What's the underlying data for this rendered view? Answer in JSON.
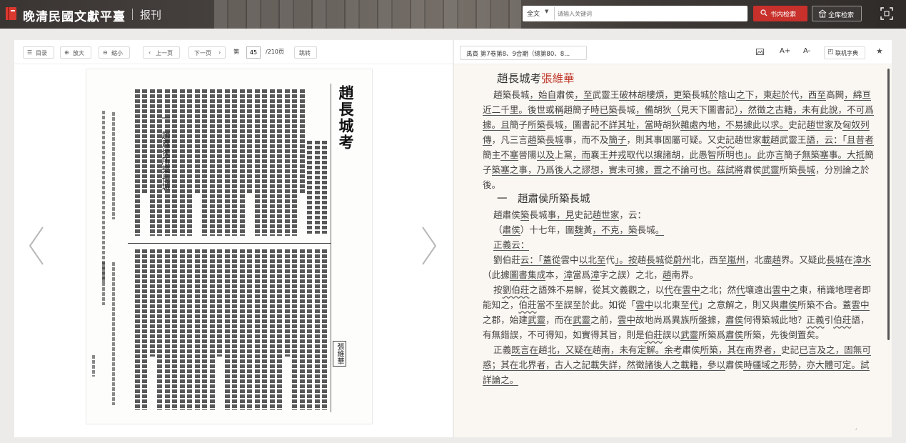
{
  "header": {
    "app_title": "晚清民國文獻平臺",
    "section": "报刊",
    "search": {
      "scope": "全文",
      "placeholder": "请输入关键词"
    },
    "search_in_book": "书内检索",
    "search_all": "全库检索"
  },
  "reader_toolbar": {
    "toc": "目录",
    "zoom_in": "放大",
    "zoom_out": "缩小",
    "prev": "上一页",
    "next": "下一页",
    "page_prefix": "第",
    "page_value": "45",
    "page_total": "/210页",
    "jump": "跳转"
  },
  "scan": {
    "title": "趙長城考",
    "section": "一　趙肅侯所築長城",
    "author": "張維華"
  },
  "text_toolbar": {
    "issue": "禹貢 第7卷第8、9合期（總第80、8...",
    "font_up": "A+",
    "font_down": "A-",
    "dictionary": "联机字典"
  },
  "article": {
    "title": "趙長城考",
    "author": "張維華",
    "p1": [
      "趙築長城",
      "，始自",
      "肅侯",
      "，至",
      "武靈王",
      "破林胡樓煩，更築",
      "長城",
      "於",
      "陰山",
      "之下，東起於",
      "代",
      "，西至",
      "高闕",
      "，綿亘近二千里。後世或稱",
      "趙簡子",
      "時已築",
      "長城",
      "，備",
      "胡狄",
      "（",
      "見天下圖書記",
      "），然徵之古籍，未有此說，不可爲據。且",
      "簡子",
      "所築",
      "長城",
      "，",
      "圖書記",
      "不詳其址，當時",
      "胡狄",
      "雜處內地，不易據此以求。",
      "史記",
      "趙世家",
      "及",
      "匈奴列傳",
      "，凡三言",
      "趙",
      "築",
      "長城",
      "事，而不及",
      "簡子",
      "，則其事固屬可疑。又",
      "史記",
      "趙世家",
      "載",
      "趙武靈王",
      "語，云：「且昔者",
      "簡主",
      "不塞",
      "晉陽",
      "以及",
      "上黨",
      "，而",
      "襄王",
      "并戎取代以攘諸胡，此愚智所明也」。此亦言",
      "簡子",
      "無築塞事。大抵",
      "簡子",
      "築塞之事，乃爲後人之謬想，實未可據，置之不論可也。茲試將",
      "肅侯",
      "武靈",
      "所築",
      "長城",
      "，分別論之於後。"
    ],
    "section1": "一　趙肅侯所築長城",
    "l1": [
      "趙肅侯",
      "築",
      "長城",
      "事，見",
      "史記",
      "趙世家",
      "，云："
    ],
    "l2": [
      "（",
      "肅侯",
      "）十七年，圍",
      "魏",
      "黃",
      "，不克，築",
      "長城",
      "。"
    ],
    "l3": "正義云：",
    "p2": [
      "劉伯莊",
      "云：「蓋從",
      "雲中",
      "以北至",
      "代",
      "」。按",
      "趙",
      "長城",
      "從",
      "蔚州",
      "北，西至",
      "嵐州",
      "，北盡",
      "趙",
      "界。又疑此",
      "長城",
      "在",
      "漳水",
      "（此據",
      "圖書集成",
      "本，",
      "漳",
      "當爲",
      "漳",
      "字之誤）之北，",
      "趙",
      "南界。"
    ],
    "p3": [
      "按",
      "劉伯莊",
      "之語殊不易解，從其文義觀之，以",
      "代",
      "在",
      "雲中",
      "之北；然",
      "代",
      "壤遠出",
      "雲中",
      "之東，稍識地理者即能知之，",
      "伯莊",
      "當不至誤至於此。如從「",
      "雲中",
      "以北東至",
      "代",
      "」之意解之，則又與",
      "肅侯",
      "所築不合。蓋",
      "雲中",
      "之郡，始建",
      "武靈",
      "，而在",
      "武靈",
      "之前，",
      "雲中",
      "故地尚爲異族所盤據，",
      "肅侯",
      "何得築城此地？",
      "正義",
      "引",
      "伯莊",
      "語，有無錯誤，不可得知，如實得其旨，則是",
      "伯莊",
      "誤以",
      "武靈",
      "所築爲",
      "肅侯",
      "所築，先後倒置矣。"
    ],
    "p4": [
      "正義",
      "既言在",
      "趙",
      "北，又疑在",
      "趙",
      "南，未有定解。余考",
      "肅侯",
      "所築，其在南界者，",
      "史記",
      "已言及之，固無可惑；其在北界者，古人之記載失詳，然徵諸後人之載籍，參以",
      "肅侯",
      "時疆域之形勢，亦大體可定。試詳論之。"
    ]
  },
  "colors": {
    "accent_red": "#c8302b",
    "author_red": "#c0392b",
    "text_bg": "#faf7f2"
  },
  "icons": [
    "book-logo-icon",
    "search-icon",
    "library-icon",
    "fullscreen-icon",
    "list-icon",
    "zoom-in-icon",
    "zoom-out-icon",
    "chevron-left-icon",
    "chevron-right-icon",
    "image-icon",
    "dictionary-icon",
    "star-icon"
  ]
}
